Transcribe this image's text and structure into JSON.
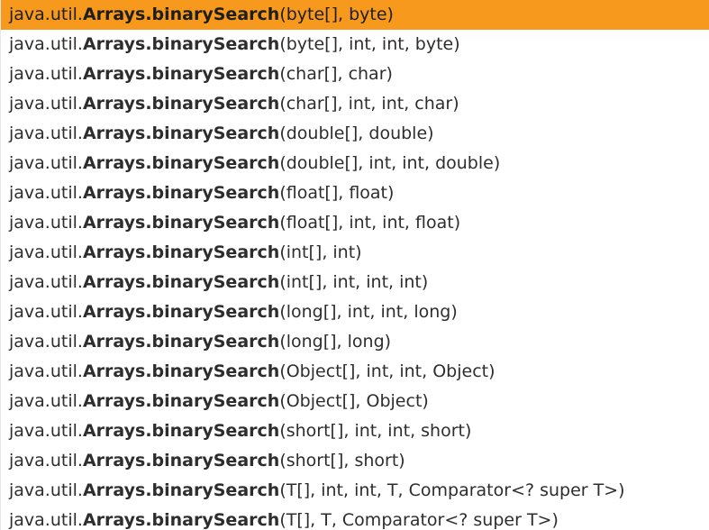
{
  "accent_color": "#f7991c",
  "selected_index": 0,
  "completions": [
    {
      "prefix": "java.util.",
      "name": "Arrays.binarySearch",
      "params": "(byte[], byte)"
    },
    {
      "prefix": "java.util.",
      "name": "Arrays.binarySearch",
      "params": "(byte[], int, int, byte)"
    },
    {
      "prefix": "java.util.",
      "name": "Arrays.binarySearch",
      "params": "(char[], char)"
    },
    {
      "prefix": "java.util.",
      "name": "Arrays.binarySearch",
      "params": "(char[], int, int, char)"
    },
    {
      "prefix": "java.util.",
      "name": "Arrays.binarySearch",
      "params": "(double[], double)"
    },
    {
      "prefix": "java.util.",
      "name": "Arrays.binarySearch",
      "params": "(double[], int, int, double)"
    },
    {
      "prefix": "java.util.",
      "name": "Arrays.binarySearch",
      "params": "(float[], float)"
    },
    {
      "prefix": "java.util.",
      "name": "Arrays.binarySearch",
      "params": "(float[], int, int, float)"
    },
    {
      "prefix": "java.util.",
      "name": "Arrays.binarySearch",
      "params": "(int[], int)"
    },
    {
      "prefix": "java.util.",
      "name": "Arrays.binarySearch",
      "params": "(int[], int, int, int)"
    },
    {
      "prefix": "java.util.",
      "name": "Arrays.binarySearch",
      "params": "(long[], int, int, long)"
    },
    {
      "prefix": "java.util.",
      "name": "Arrays.binarySearch",
      "params": "(long[], long)"
    },
    {
      "prefix": "java.util.",
      "name": "Arrays.binarySearch",
      "params": "(Object[], int, int, Object)"
    },
    {
      "prefix": "java.util.",
      "name": "Arrays.binarySearch",
      "params": "(Object[], Object)"
    },
    {
      "prefix": "java.util.",
      "name": "Arrays.binarySearch",
      "params": "(short[], int, int, short)"
    },
    {
      "prefix": "java.util.",
      "name": "Arrays.binarySearch",
      "params": "(short[], short)"
    },
    {
      "prefix": "java.util.",
      "name": "Arrays.binarySearch",
      "params": "(T[], int, int, T, Comparator<? super T>)"
    },
    {
      "prefix": "java.util.",
      "name": "Arrays.binarySearch",
      "params": "(T[], T, Comparator<? super T>)"
    }
  ]
}
